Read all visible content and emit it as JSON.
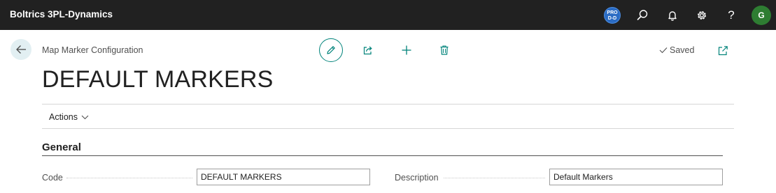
{
  "header": {
    "app_title": "Boltrics 3PL-Dynamics",
    "env_badge": {
      "line1": "PRO",
      "line2": "D-D"
    },
    "icons": [
      "search-icon",
      "bell-icon",
      "gear-icon",
      "help-icon"
    ],
    "help_glyph": "?",
    "avatar_initial": "G",
    "colors": {
      "bar": "#212121",
      "avatar": "#2e7d32",
      "badge": "#2b6cc4"
    }
  },
  "page": {
    "breadcrumb": "Map Marker Configuration",
    "title": "DEFAULT MARKERS",
    "saved_label": "Saved",
    "toolbar_icons": [
      "edit-icon",
      "share-icon",
      "add-icon",
      "delete-icon"
    ],
    "accent_color": "#00837a"
  },
  "actions": {
    "label": "Actions"
  },
  "general": {
    "section_title": "General",
    "fields": {
      "code": {
        "label": "Code",
        "value": "DEFAULT MARKERS"
      },
      "description": {
        "label": "Description",
        "value": "Default Markers"
      }
    }
  }
}
